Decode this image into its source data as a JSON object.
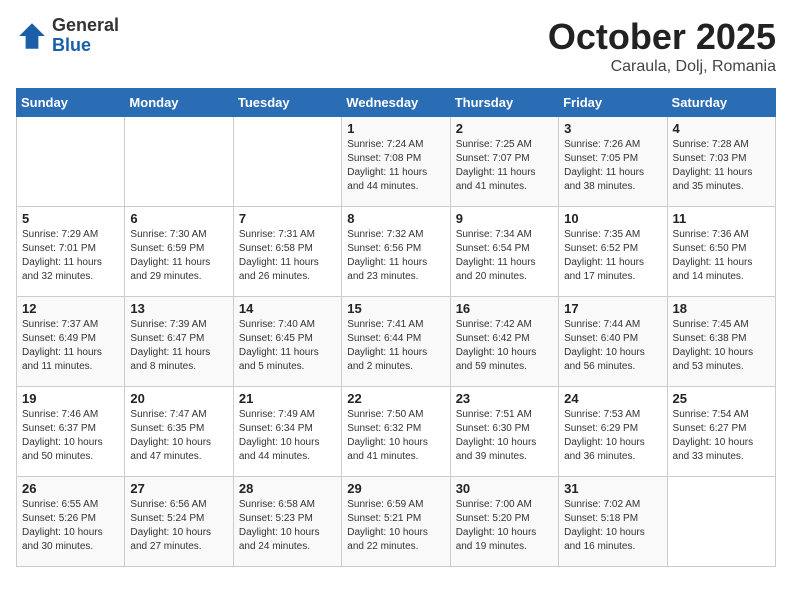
{
  "logo": {
    "general": "General",
    "blue": "Blue"
  },
  "title": "October 2025",
  "subtitle": "Caraula, Dolj, Romania",
  "days_of_week": [
    "Sunday",
    "Monday",
    "Tuesday",
    "Wednesday",
    "Thursday",
    "Friday",
    "Saturday"
  ],
  "weeks": [
    [
      {
        "day": "",
        "info": ""
      },
      {
        "day": "",
        "info": ""
      },
      {
        "day": "",
        "info": ""
      },
      {
        "day": "1",
        "info": "Sunrise: 7:24 AM\nSunset: 7:08 PM\nDaylight: 11 hours and 44 minutes."
      },
      {
        "day": "2",
        "info": "Sunrise: 7:25 AM\nSunset: 7:07 PM\nDaylight: 11 hours and 41 minutes."
      },
      {
        "day": "3",
        "info": "Sunrise: 7:26 AM\nSunset: 7:05 PM\nDaylight: 11 hours and 38 minutes."
      },
      {
        "day": "4",
        "info": "Sunrise: 7:28 AM\nSunset: 7:03 PM\nDaylight: 11 hours and 35 minutes."
      }
    ],
    [
      {
        "day": "5",
        "info": "Sunrise: 7:29 AM\nSunset: 7:01 PM\nDaylight: 11 hours and 32 minutes."
      },
      {
        "day": "6",
        "info": "Sunrise: 7:30 AM\nSunset: 6:59 PM\nDaylight: 11 hours and 29 minutes."
      },
      {
        "day": "7",
        "info": "Sunrise: 7:31 AM\nSunset: 6:58 PM\nDaylight: 11 hours and 26 minutes."
      },
      {
        "day": "8",
        "info": "Sunrise: 7:32 AM\nSunset: 6:56 PM\nDaylight: 11 hours and 23 minutes."
      },
      {
        "day": "9",
        "info": "Sunrise: 7:34 AM\nSunset: 6:54 PM\nDaylight: 11 hours and 20 minutes."
      },
      {
        "day": "10",
        "info": "Sunrise: 7:35 AM\nSunset: 6:52 PM\nDaylight: 11 hours and 17 minutes."
      },
      {
        "day": "11",
        "info": "Sunrise: 7:36 AM\nSunset: 6:50 PM\nDaylight: 11 hours and 14 minutes."
      }
    ],
    [
      {
        "day": "12",
        "info": "Sunrise: 7:37 AM\nSunset: 6:49 PM\nDaylight: 11 hours and 11 minutes."
      },
      {
        "day": "13",
        "info": "Sunrise: 7:39 AM\nSunset: 6:47 PM\nDaylight: 11 hours and 8 minutes."
      },
      {
        "day": "14",
        "info": "Sunrise: 7:40 AM\nSunset: 6:45 PM\nDaylight: 11 hours and 5 minutes."
      },
      {
        "day": "15",
        "info": "Sunrise: 7:41 AM\nSunset: 6:44 PM\nDaylight: 11 hours and 2 minutes."
      },
      {
        "day": "16",
        "info": "Sunrise: 7:42 AM\nSunset: 6:42 PM\nDaylight: 10 hours and 59 minutes."
      },
      {
        "day": "17",
        "info": "Sunrise: 7:44 AM\nSunset: 6:40 PM\nDaylight: 10 hours and 56 minutes."
      },
      {
        "day": "18",
        "info": "Sunrise: 7:45 AM\nSunset: 6:38 PM\nDaylight: 10 hours and 53 minutes."
      }
    ],
    [
      {
        "day": "19",
        "info": "Sunrise: 7:46 AM\nSunset: 6:37 PM\nDaylight: 10 hours and 50 minutes."
      },
      {
        "day": "20",
        "info": "Sunrise: 7:47 AM\nSunset: 6:35 PM\nDaylight: 10 hours and 47 minutes."
      },
      {
        "day": "21",
        "info": "Sunrise: 7:49 AM\nSunset: 6:34 PM\nDaylight: 10 hours and 44 minutes."
      },
      {
        "day": "22",
        "info": "Sunrise: 7:50 AM\nSunset: 6:32 PM\nDaylight: 10 hours and 41 minutes."
      },
      {
        "day": "23",
        "info": "Sunrise: 7:51 AM\nSunset: 6:30 PM\nDaylight: 10 hours and 39 minutes."
      },
      {
        "day": "24",
        "info": "Sunrise: 7:53 AM\nSunset: 6:29 PM\nDaylight: 10 hours and 36 minutes."
      },
      {
        "day": "25",
        "info": "Sunrise: 7:54 AM\nSunset: 6:27 PM\nDaylight: 10 hours and 33 minutes."
      }
    ],
    [
      {
        "day": "26",
        "info": "Sunrise: 6:55 AM\nSunset: 5:26 PM\nDaylight: 10 hours and 30 minutes."
      },
      {
        "day": "27",
        "info": "Sunrise: 6:56 AM\nSunset: 5:24 PM\nDaylight: 10 hours and 27 minutes."
      },
      {
        "day": "28",
        "info": "Sunrise: 6:58 AM\nSunset: 5:23 PM\nDaylight: 10 hours and 24 minutes."
      },
      {
        "day": "29",
        "info": "Sunrise: 6:59 AM\nSunset: 5:21 PM\nDaylight: 10 hours and 22 minutes."
      },
      {
        "day": "30",
        "info": "Sunrise: 7:00 AM\nSunset: 5:20 PM\nDaylight: 10 hours and 19 minutes."
      },
      {
        "day": "31",
        "info": "Sunrise: 7:02 AM\nSunset: 5:18 PM\nDaylight: 10 hours and 16 minutes."
      },
      {
        "day": "",
        "info": ""
      }
    ]
  ]
}
